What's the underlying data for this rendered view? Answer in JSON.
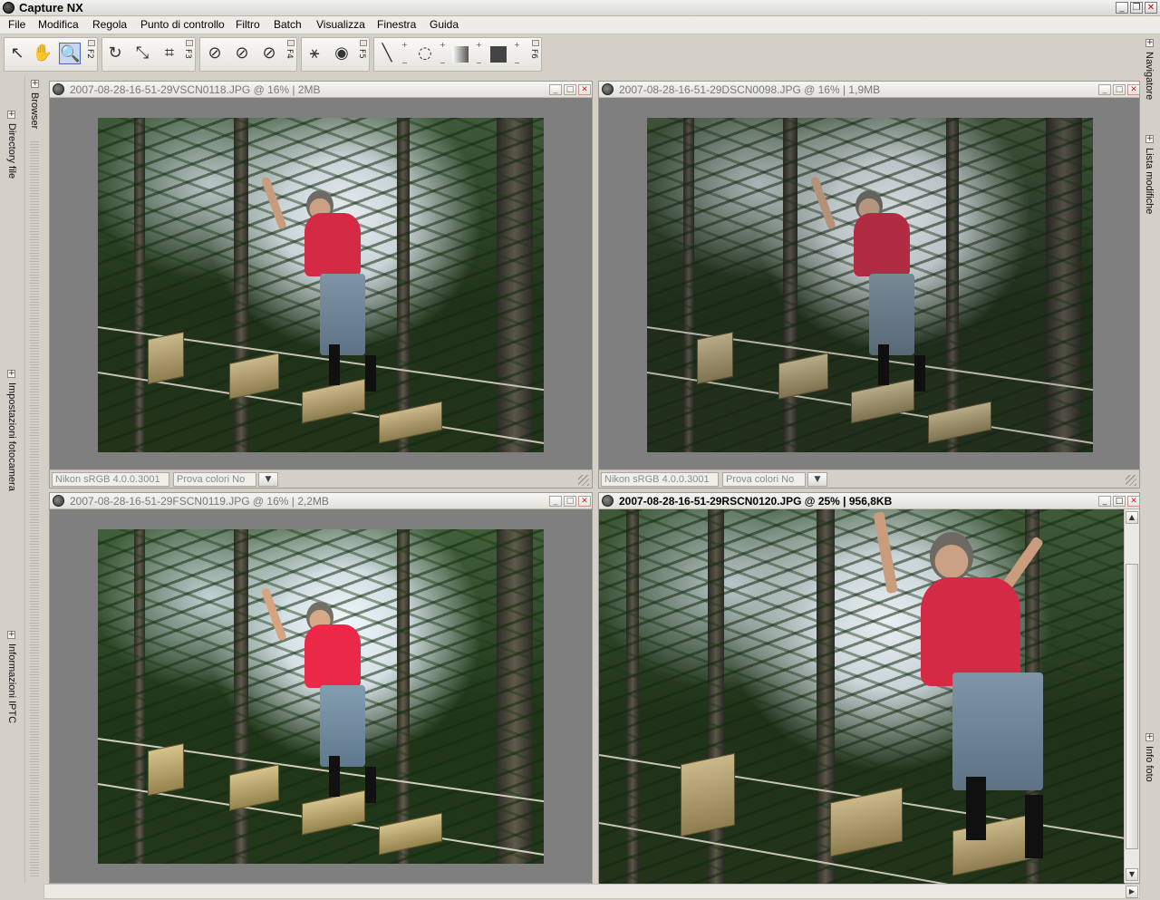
{
  "app": {
    "title": "Capture NX",
    "logo_icon": "nikon-logo-icon"
  },
  "window_controls": {
    "minimize": "_",
    "restore": "❐",
    "close": "✕"
  },
  "menu": [
    "File",
    "Modifica",
    "Regola",
    "Punto di controllo",
    "Filtro",
    "Batch",
    "Visualizza",
    "Finestra",
    "Guida"
  ],
  "toolbar": {
    "groups": [
      {
        "key": "F2",
        "tools": [
          "arrow-select-icon",
          "hand-pan-icon",
          "zoom-icon"
        ],
        "active": "zoom-icon"
      },
      {
        "key": "F3",
        "tools": [
          "rotate-icon",
          "straighten-icon",
          "crop-icon"
        ]
      },
      {
        "key": "F4",
        "tools": [
          "black-point-dropper-icon",
          "neutral-point-dropper-icon",
          "white-point-dropper-icon"
        ]
      },
      {
        "key": "F5",
        "tools": [
          "red-eye-icon",
          "eye-icon"
        ]
      },
      {
        "key": "F6",
        "tools": [
          "brush-icon",
          "lasso-icon",
          "gradient-icon",
          "fill-icon"
        ]
      }
    ]
  },
  "left_panels": [
    "Browser",
    "Directory file",
    "Impostazioni fotocamera",
    "Informazioni IPTC"
  ],
  "right_panels": [
    "Navigatore",
    "Lista modifiche",
    "Info foto"
  ],
  "documents": [
    {
      "title": "2007-08-28-16-51-29VSCN0118.JPG  @  16%  |  2MB",
      "profile": "Nikon sRGB 4.0.0.3001",
      "softproof": "Prova colori No",
      "active": false
    },
    {
      "title": "2007-08-28-16-51-29DSCN0098.JPG  @  16%  |  1,9MB",
      "profile": "Nikon sRGB 4.0.0.3001",
      "softproof": "Prova colori No",
      "active": false
    },
    {
      "title": "2007-08-28-16-51-29FSCN0119.JPG  @  16%  |  2,2MB",
      "profile": "",
      "softproof": "",
      "active": false
    },
    {
      "title": "2007-08-28-16-51-29RSCN0120.JPG  @  25%  |  956,8KB",
      "profile": "",
      "softproof": "",
      "active": true
    }
  ]
}
